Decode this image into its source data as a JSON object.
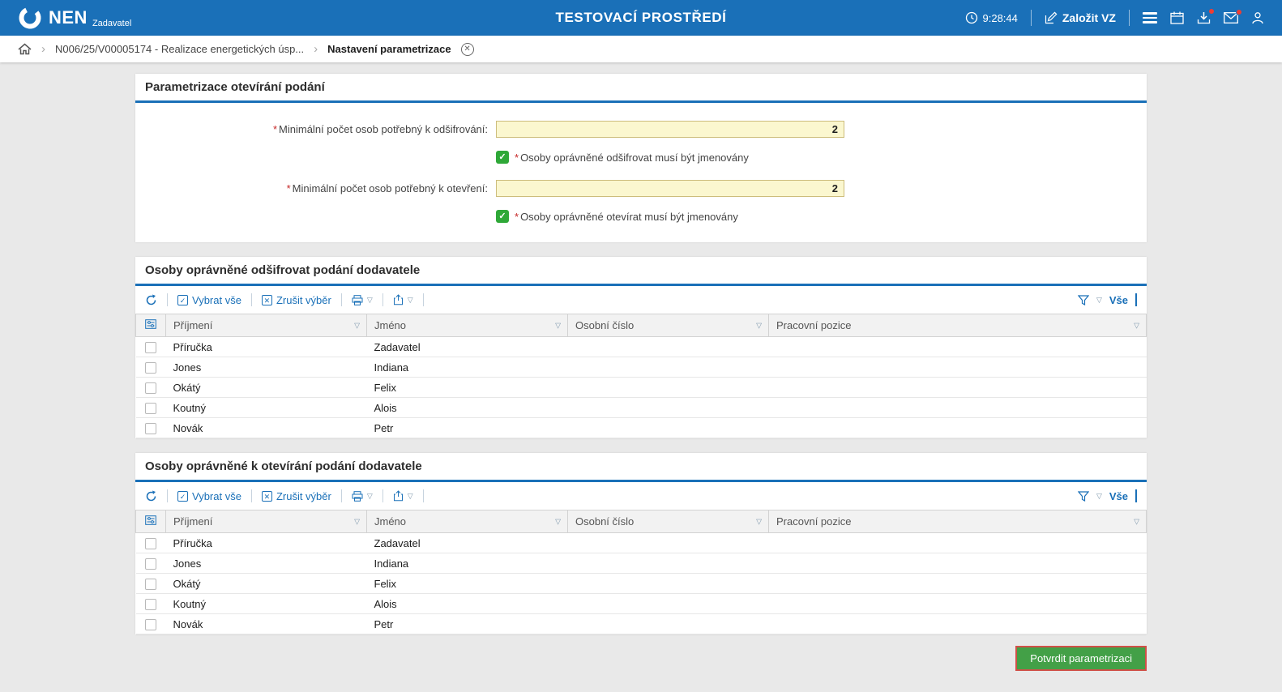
{
  "topbar": {
    "brand": "NEN",
    "brand_sub": "Zadavatel",
    "env_title": "TESTOVACÍ PROSTŘEDÍ",
    "time": "9:28:44",
    "create_vz_label": "Založit VZ"
  },
  "breadcrumb": {
    "contract": "N006/25/V00005174 - Realizace energetických úsp...",
    "current": "Nastavení parametrizace"
  },
  "parametrization": {
    "title": "Parametrizace otevírání podání",
    "required_marker": "*",
    "min_decrypt_label": "Minimální počet osob potřebný k odšifrování:",
    "min_decrypt_value": "2",
    "decrypt_named_label": "Osoby oprávněné odšifrovat musí být jmenovány",
    "min_open_label": "Minimální počet osob potřebný k otevření:",
    "min_open_value": "2",
    "open_named_label": "Osoby oprávněné otevírat musí být jmenovány"
  },
  "toolbar": {
    "select_all": "Vybrat vše",
    "clear_selection": "Zrušit výběr",
    "all_filter": "Vše"
  },
  "columns": {
    "surname": "Příjmení",
    "name": "Jméno",
    "personal_number": "Osobní číslo",
    "position": "Pracovní pozice"
  },
  "decrypt_table": {
    "title": "Osoby oprávněné odšifrovat podání dodavatele",
    "rows": [
      {
        "surname": "Příručka",
        "name": "Zadavatel",
        "personal_number": "",
        "position": ""
      },
      {
        "surname": "Jones",
        "name": "Indiana",
        "personal_number": "",
        "position": ""
      },
      {
        "surname": "Okátý",
        "name": "Felix",
        "personal_number": "",
        "position": ""
      },
      {
        "surname": "Koutný",
        "name": "Alois",
        "personal_number": "",
        "position": ""
      },
      {
        "surname": "Novák",
        "name": "Petr",
        "personal_number": "",
        "position": ""
      }
    ]
  },
  "open_table": {
    "title": "Osoby oprávněné k otevírání podání dodavatele",
    "rows": [
      {
        "surname": "Příručka",
        "name": "Zadavatel",
        "personal_number": "",
        "position": ""
      },
      {
        "surname": "Jones",
        "name": "Indiana",
        "personal_number": "",
        "position": ""
      },
      {
        "surname": "Okátý",
        "name": "Felix",
        "personal_number": "",
        "position": ""
      },
      {
        "surname": "Koutný",
        "name": "Alois",
        "personal_number": "",
        "position": ""
      },
      {
        "surname": "Novák",
        "name": "Petr",
        "personal_number": "",
        "position": ""
      }
    ]
  },
  "footer": {
    "confirm_label": "Potvrdit parametrizaci"
  },
  "colors": {
    "primary_blue": "#1a70b8",
    "input_yellow": "#fbf7cf",
    "checkbox_green": "#2fa838",
    "button_green": "#43a047",
    "badge_red": "#ef3d33"
  }
}
